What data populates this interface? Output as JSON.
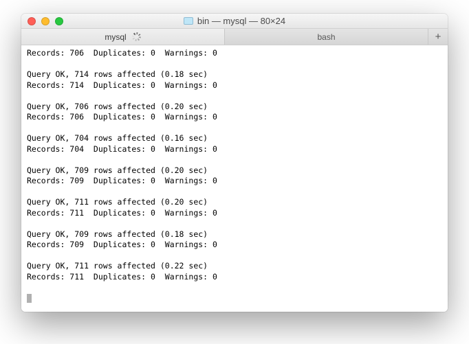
{
  "window": {
    "title": "bin — mysql — 80×24"
  },
  "tabs": {
    "active": "mysql",
    "inactive": "bash",
    "plus": "+"
  },
  "blocks": [
    {
      "query": "",
      "records": "Records: 706  Duplicates: 0  Warnings: 0"
    },
    {
      "query": "Query OK, 714 rows affected (0.18 sec)",
      "records": "Records: 714  Duplicates: 0  Warnings: 0"
    },
    {
      "query": "Query OK, 706 rows affected (0.20 sec)",
      "records": "Records: 706  Duplicates: 0  Warnings: 0"
    },
    {
      "query": "Query OK, 704 rows affected (0.16 sec)",
      "records": "Records: 704  Duplicates: 0  Warnings: 0"
    },
    {
      "query": "Query OK, 709 rows affected (0.20 sec)",
      "records": "Records: 709  Duplicates: 0  Warnings: 0"
    },
    {
      "query": "Query OK, 711 rows affected (0.20 sec)",
      "records": "Records: 711  Duplicates: 0  Warnings: 0"
    },
    {
      "query": "Query OK, 709 rows affected (0.18 sec)",
      "records": "Records: 709  Duplicates: 0  Warnings: 0"
    },
    {
      "query": "Query OK, 711 rows affected (0.22 sec)",
      "records": "Records: 711  Duplicates: 0  Warnings: 0"
    }
  ]
}
